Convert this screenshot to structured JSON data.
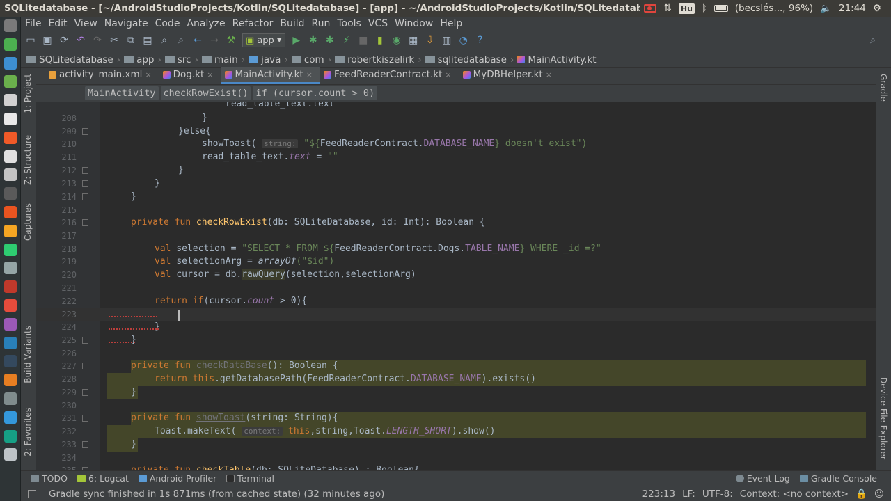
{
  "os": {
    "window_title": "SQLitedatabase - [~/AndroidStudioProjects/Kotlin/SQLitedatabase] - [app] - ~/AndroidStudioProjects/Kotlin/SQLitedatabase/app/src/m",
    "keyboard": "Hu",
    "battery_text": "(becslés..., 96%)",
    "clock": "21:44"
  },
  "menu": [
    "File",
    "Edit",
    "View",
    "Navigate",
    "Code",
    "Analyze",
    "Refactor",
    "Build",
    "Run",
    "Tools",
    "VCS",
    "Window",
    "Help"
  ],
  "toolbar": {
    "run_config": "app"
  },
  "nav": [
    "SQLitedatabase",
    "app",
    "src",
    "main",
    "java",
    "com",
    "robertkiszelirk",
    "sqlitedatabase",
    "MainActivity.kt"
  ],
  "tabs": [
    {
      "label": "activity_main.xml",
      "kind": "xml",
      "active": false
    },
    {
      "label": "Dog.kt",
      "kind": "kt",
      "active": false
    },
    {
      "label": "MainActivity.kt",
      "kind": "kt",
      "active": true
    },
    {
      "label": "FeedReaderContract.kt",
      "kind": "kt",
      "active": false
    },
    {
      "label": "MyDBHelper.kt",
      "kind": "kt",
      "active": false
    }
  ],
  "editor_breadcrumb": [
    "MainActivity",
    "checkRowExist()",
    "if (cursor.count > 0)"
  ],
  "left_tools": [
    "1: Project",
    "Z: Structure",
    "Captures",
    "Build Variants",
    "2: Favorites"
  ],
  "right_tools": [
    "Gradle",
    "Device File Explorer"
  ],
  "line_numbers": [
    "208",
    "209",
    "210",
    "211",
    "212",
    "213",
    "214",
    "215",
    "216",
    "217",
    "218",
    "219",
    "220",
    "221",
    "222",
    "223",
    "224",
    "225",
    "226",
    "227",
    "228",
    "229",
    "230",
    "231",
    "232",
    "233",
    "234",
    "235"
  ],
  "code": {
    "l207": "read_table_text.text",
    "l208": "}",
    "l209_else": "}else{",
    "l210_call": "showToast(",
    "l210_hint": "string:",
    "l210_str_a": "\"${",
    "l210_const": "FeedReaderContract.",
    "l210_const2": "DATABASE_NAME",
    "l210_str_b": "} doesn't exist\")",
    "l211_a": "read_table_text.",
    "l211_prop": "text",
    "l211_b": " = ",
    "l211_str": "\"\"",
    "l212": "}",
    "l213": "}",
    "l216_kw": "private fun ",
    "l216_fn": "checkRowExist",
    "l216_rest": "(db: SQLiteDatabase, id: Int): Boolean {",
    "l218_kw": "val ",
    "l218_a": "selection = ",
    "l218_str": "\"SELECT * FROM ${",
    "l218_b": "FeedReaderContract.Dogs.",
    "l218_c": "TABLE_NAME",
    "l218_str2": "} WHERE _id =?\"",
    "l219_kw": "val ",
    "l219_a": "selectionArg = ",
    "l219_fn": "arrayOf",
    "l219_str": "(\"$id\")",
    "l220_kw": "val ",
    "l220_a": "cursor = db.",
    "l220_fn": "rawQuery",
    "l220_b": "(selection,selectionArg)",
    "l222_kw": "return ",
    "l222_if": "if",
    "l222_a": "(cursor.",
    "l222_prop": "count",
    "l222_b": " > 0){",
    "l224": "}",
    "l225": "}",
    "l227_kw": "private fun ",
    "l227_fn": "checkDataBase",
    "l227_rest": "(): Boolean {",
    "l228_kw": "return ",
    "l228_this": "this",
    "l228_a": ".getDatabasePath(FeedReaderContract.",
    "l228_c": "DATABASE_NAME",
    "l228_b": ").exists()",
    "l229": "}",
    "l231_kw": "private fun ",
    "l231_fn": "showToast",
    "l231_rest": "(string: String){",
    "l232_a": "Toast.makeText(",
    "l232_hint": "context:",
    "l232_this": "this",
    "l232_b": ",string,Toast.",
    "l232_c": "LENGTH_SHORT",
    "l232_d": ").show()",
    "l233": "}",
    "l235_kw": "private fun ",
    "l235_fn": "checkTable",
    "l235_rest": "(db: SQLiteDatabase) : Boolean{"
  },
  "bottom_tools": [
    "TODO",
    "6: Logcat",
    "Android Profiler",
    "Terminal",
    "Event Log",
    "Gradle Console"
  ],
  "status": {
    "message": "Gradle sync finished in 1s 871ms (from cached state) (32 minutes ago)",
    "position": "223:13",
    "line_sep": "LF:",
    "encoding": "UTF-8:",
    "context": "Context: <no context>"
  }
}
